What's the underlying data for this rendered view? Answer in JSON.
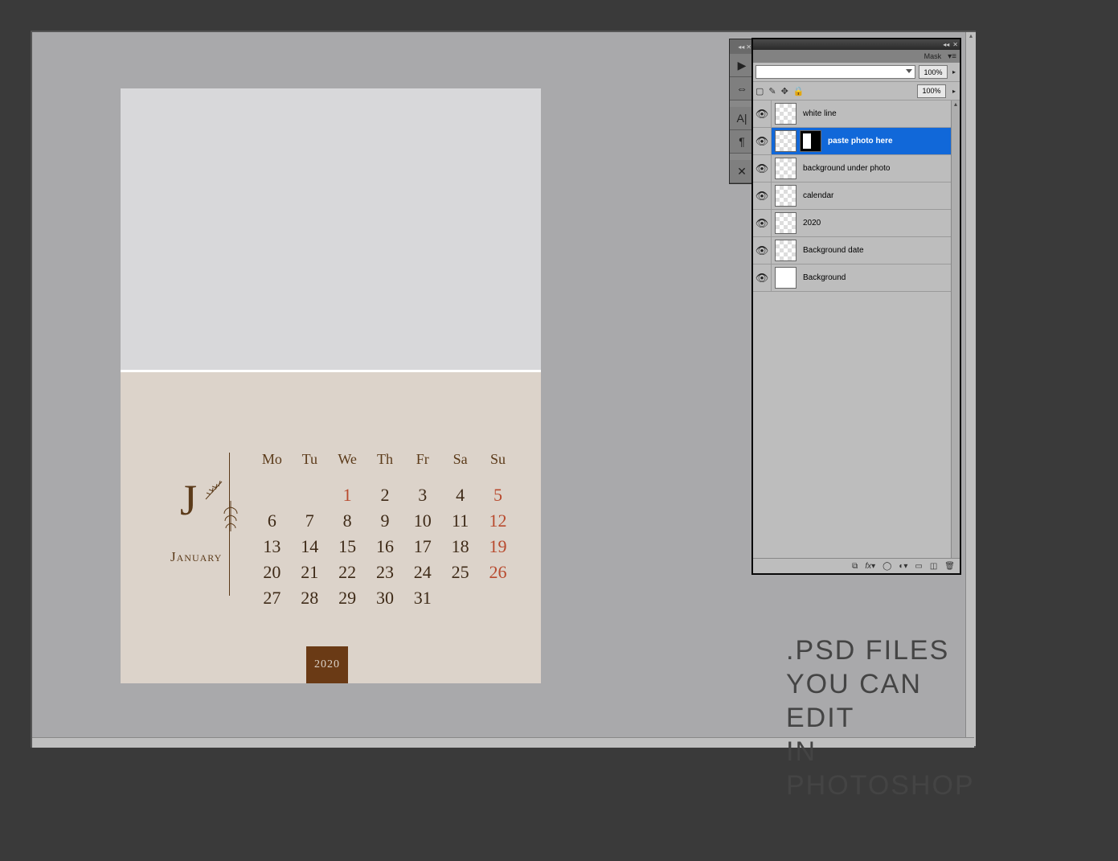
{
  "calendar": {
    "year": "2020",
    "month_letter": "J",
    "month_name": "January",
    "day_headers": [
      "Mo",
      "Tu",
      "We",
      "Th",
      "Fr",
      "Sa",
      "Su"
    ],
    "weeks": [
      [
        {
          "n": ""
        },
        {
          "n": ""
        },
        {
          "n": "1",
          "h": true
        },
        {
          "n": "2"
        },
        {
          "n": "3"
        },
        {
          "n": "4"
        },
        {
          "n": "5",
          "s": true
        }
      ],
      [
        {
          "n": "6"
        },
        {
          "n": "7"
        },
        {
          "n": "8"
        },
        {
          "n": "9"
        },
        {
          "n": "10"
        },
        {
          "n": "11"
        },
        {
          "n": "12",
          "s": true
        }
      ],
      [
        {
          "n": "13"
        },
        {
          "n": "14"
        },
        {
          "n": "15"
        },
        {
          "n": "16"
        },
        {
          "n": "17"
        },
        {
          "n": "18"
        },
        {
          "n": "19",
          "s": true
        }
      ],
      [
        {
          "n": "20"
        },
        {
          "n": "21"
        },
        {
          "n": "22"
        },
        {
          "n": "23"
        },
        {
          "n": "24"
        },
        {
          "n": "25"
        },
        {
          "n": "26",
          "s": true
        }
      ],
      [
        {
          "n": "27"
        },
        {
          "n": "28"
        },
        {
          "n": "29"
        },
        {
          "n": "30"
        },
        {
          "n": "31"
        },
        {
          "n": ""
        },
        {
          "n": ""
        }
      ]
    ]
  },
  "layers_panel": {
    "tab_label": "Mask",
    "opacity": "100%",
    "fill": "100%",
    "layers": [
      {
        "name": "white line",
        "visible": true,
        "mask": false,
        "selected": false,
        "thumb": "checker"
      },
      {
        "name": "paste photo here",
        "visible": true,
        "mask": true,
        "selected": true,
        "thumb": "checker"
      },
      {
        "name": "background under photo",
        "visible": true,
        "mask": false,
        "selected": false,
        "thumb": "checker"
      },
      {
        "name": "calendar",
        "visible": true,
        "mask": false,
        "selected": false,
        "thumb": "checker"
      },
      {
        "name": "2020",
        "visible": true,
        "mask": false,
        "selected": false,
        "thumb": "checker"
      },
      {
        "name": "Background date",
        "visible": true,
        "mask": false,
        "selected": false,
        "thumb": "checker"
      },
      {
        "name": "Background",
        "visible": true,
        "mask": false,
        "selected": false,
        "thumb": "white"
      }
    ]
  },
  "caption": {
    "line1": ".PSD FILES",
    "line2": "YOU CAN EDIT",
    "line3": "IN PHOTOSHOP"
  },
  "tool_icons": [
    "▶",
    "⇔",
    "A|",
    "¶",
    "✕"
  ]
}
